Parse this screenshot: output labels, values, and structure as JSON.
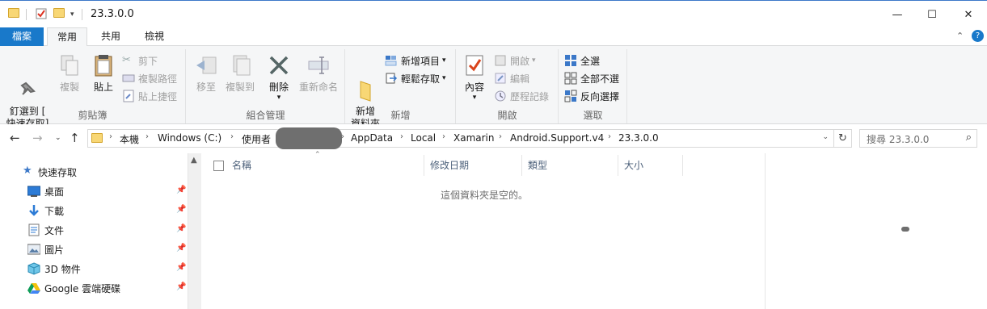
{
  "window": {
    "title": "23.3.0.0",
    "minimize": "—",
    "maximize": "☐",
    "close": "✕"
  },
  "ribbon_tabs": [
    "檔案",
    "常用",
    "共用",
    "檢視"
  ],
  "ribbon": {
    "clipboard": {
      "label": "剪貼簿",
      "pin": "釘選到 [\n快速存取]",
      "copy": "複製",
      "paste": "貼上",
      "cut": "剪下",
      "copy_path": "複製路徑",
      "paste_shortcut": "貼上捷徑"
    },
    "organize": {
      "label": "組合管理",
      "move_to": "移至",
      "copy_to": "複製到",
      "delete": "刪除",
      "rename": "重新命名"
    },
    "new": {
      "label": "新增",
      "new_folder": "新增\n資料夾",
      "new_item": "新增項目",
      "easy_access": "輕鬆存取"
    },
    "open": {
      "label": "開啟",
      "properties": "內容",
      "open": "開啟",
      "edit": "編輯",
      "history": "歷程記錄"
    },
    "select": {
      "label": "選取",
      "select_all": "全選",
      "select_none": "全部不選",
      "invert": "反向選擇"
    }
  },
  "address": {
    "crumbs": [
      "本機",
      "Windows (C:)",
      "使用者",
      "AppData",
      "Local",
      "Xamarin",
      "Android.Support.v4",
      "23.3.0.0"
    ],
    "search_placeholder": "搜尋 23.3.0.0"
  },
  "nav": {
    "items": [
      {
        "label": "快速存取",
        "icon": "star-icon"
      },
      {
        "label": "桌面",
        "icon": "desktop-icon"
      },
      {
        "label": "下載",
        "icon": "download-icon"
      },
      {
        "label": "文件",
        "icon": "document-icon"
      },
      {
        "label": "圖片",
        "icon": "picture-icon"
      },
      {
        "label": "3D 物件",
        "icon": "cube-icon"
      },
      {
        "label": "Google 雲端硬碟",
        "icon": "google-drive-icon"
      }
    ]
  },
  "columns": [
    "名稱",
    "修改日期",
    "類型",
    "大小"
  ],
  "empty_message": "這個資料夾是空的。",
  "colors": {
    "accent": "#1979ca",
    "folder": "#f8d775",
    "ribbon_bg": "#f5f6f7"
  }
}
